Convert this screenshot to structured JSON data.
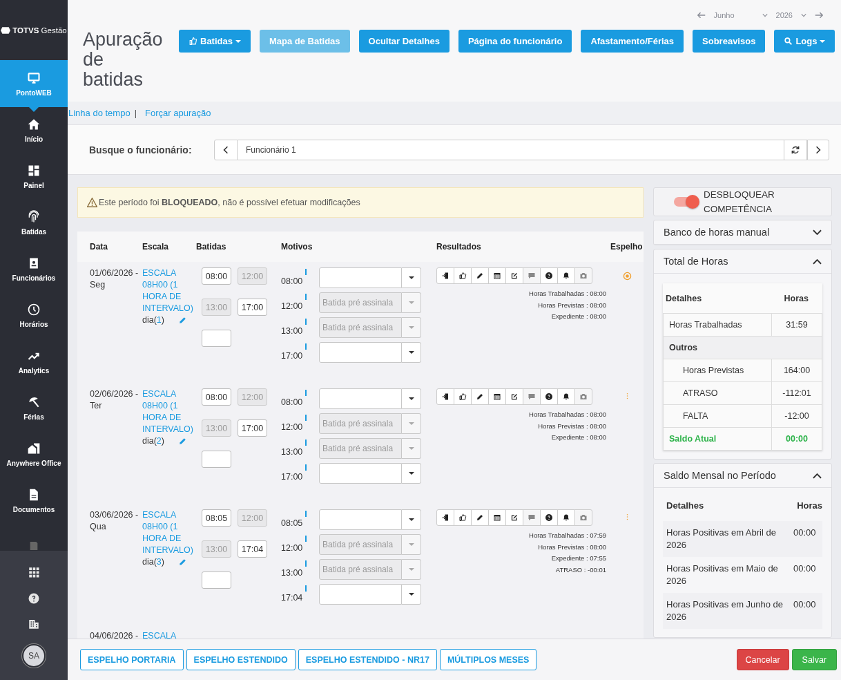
{
  "sidebar": {
    "logo": "**TOTVS** Gestão",
    "items": [
      {
        "label": "PontoWEB",
        "selected": true
      },
      {
        "label": "Início",
        "selected": false
      },
      {
        "label": "Painel",
        "selected": false
      },
      {
        "label": "Batidas",
        "selected": false
      },
      {
        "label": "Funcionários",
        "selected": false
      },
      {
        "label": "Horários",
        "selected": false
      },
      {
        "label": "Analytics",
        "selected": false
      },
      {
        "label": "Férias",
        "selected": false
      },
      {
        "label": "Anywhere Office",
        "selected": false
      },
      {
        "label": "Documentos",
        "selected": false
      },
      {
        "selected": false
      }
    ],
    "avatar": "SA"
  },
  "period": {
    "month": "Junho",
    "year": "2026"
  },
  "title": "Apuração de batidas",
  "toolbar": [
    {
      "label": "Batidas",
      "caret": true,
      "disabled": false
    },
    {
      "label": "Mapa de Batidas",
      "caret": false,
      "disabled": true
    },
    {
      "label": "Ocultar Detalhes",
      "caret": false,
      "disabled": false
    },
    {
      "label": "Página do funcionário",
      "caret": false,
      "disabled": false
    },
    {
      "label": "Afastamento/Férias",
      "caret": false,
      "disabled": false
    },
    {
      "label": "Sobreavisos",
      "caret": false,
      "disabled": false
    },
    {
      "label": "Logs",
      "caret": true,
      "disabled": false
    }
  ],
  "links": {
    "items": [
      "Linha do tempo",
      "Forçar apuração"
    ],
    "separator": "|"
  },
  "search": {
    "label": "Busque o funcionário:",
    "value": "Funcionário 1"
  },
  "notice": "Este período foi **BLOQUEADO**, não é possível efetuar modificações",
  "table": {
    "columns": [
      "Data",
      "Escala",
      "Batidas",
      "Motivos",
      "Resultados",
      "Espelho"
    ],
    "actions": [
      {
        "disabled": false
      },
      {
        "disabled": false
      },
      {
        "disabled": false
      },
      {
        "disabled": false
      },
      {
        "disabled": false
      },
      {
        "disabled": true
      },
      {
        "disabled": false
      },
      {
        "disabled": false
      },
      {
        "disabled": true
      }
    ],
    "days": [
      {
        "date": "01/06/2026 -",
        "weekday": "Seg",
        "escala": "ESCALA 08H00 (1 HORA DE INTERVALO)",
        "counter": {
          "prefix": "dia(",
          "number": "1",
          "suffix": ")"
        },
        "punches": [
          {
            "value": "08:00",
            "disabled": false
          },
          {
            "value": "12:00",
            "disabled": true
          },
          {
            "value": "13:00",
            "disabled": true
          },
          {
            "value": "17:00",
            "disabled": false
          }
        ],
        "motives": [
          {
            "time": "08:00",
            "disabled": false
          },
          {
            "time": "12:00",
            "disabled": true,
            "placeholder": "Batida pré assinala"
          },
          {
            "time": "13:00",
            "disabled": true,
            "placeholder": "Batida pré assinala"
          },
          {
            "time": "17:00",
            "disabled": false
          }
        ],
        "summary": [
          "Horas Trabalhadas : 08:00",
          "Horas Previstas : 08:00",
          "Expediente : 08:00"
        ],
        "mirror": {
          "kind": "target"
        }
      },
      {
        "date": "02/06/2026 -",
        "weekday": "Ter",
        "escala": "ESCALA 08H00 (1 HORA DE INTERVALO)",
        "counter": {
          "prefix": "dia(",
          "number": "2",
          "suffix": ")"
        },
        "punches": [
          {
            "value": "08:00",
            "disabled": false
          },
          {
            "value": "12:00",
            "disabled": true
          },
          {
            "value": "13:00",
            "disabled": true
          },
          {
            "value": "17:00",
            "disabled": false
          }
        ],
        "motives": [
          {
            "time": "08:00",
            "disabled": false
          },
          {
            "time": "12:00",
            "disabled": true,
            "placeholder": "Batida pré assinala"
          },
          {
            "time": "13:00",
            "disabled": true,
            "placeholder": "Batida pré assinala"
          },
          {
            "time": "17:00",
            "disabled": false
          }
        ],
        "summary": [
          "Horas Trabalhadas : 08:00",
          "Horas Previstas : 08:00",
          "Expediente : 08:00"
        ],
        "mirror": {
          "kind": "menu"
        }
      },
      {
        "date": "03/06/2026 -",
        "weekday": "Qua",
        "escala": "ESCALA 08H00 (1 HORA DE INTERVALO)",
        "counter": {
          "prefix": "dia(",
          "number": "3",
          "suffix": ")"
        },
        "punches": [
          {
            "value": "08:05",
            "disabled": false
          },
          {
            "value": "12:00",
            "disabled": true
          },
          {
            "value": "13:00",
            "disabled": true
          },
          {
            "value": "17:04",
            "disabled": false
          }
        ],
        "motives": [
          {
            "time": "08:05",
            "disabled": false
          },
          {
            "time": "12:00",
            "disabled": true,
            "placeholder": "Batida pré assinala"
          },
          {
            "time": "13:00",
            "disabled": true,
            "placeholder": "Batida pré assinala"
          },
          {
            "time": "17:04",
            "disabled": false
          }
        ],
        "summary": [
          "Horas Trabalhadas : 07:59",
          "Horas Previstas : 08:00",
          "Expediente : 07:55",
          "ATRASO : -00:01"
        ],
        "mirror": {
          "kind": "menu"
        }
      },
      {
        "date": "04/06/2026 -",
        "escala": "ESCALA"
      }
    ]
  },
  "right_panel": {
    "unlock": {
      "label": "DESBLOQUEAR COMPETÊNCIA",
      "on": true
    },
    "sections": [
      {
        "title": "Banco de horas manual",
        "expanded": false
      },
      {
        "title": "Total de Horas",
        "expanded": true,
        "kind": "totals",
        "columns": [
          "Detalhes",
          "Horas"
        ],
        "rows": [
          {
            "kind": "row",
            "label": "Horas Trabalhadas",
            "value": "31:59"
          },
          {
            "kind": "group",
            "label": "Outros"
          },
          {
            "kind": "sub",
            "label": "Horas Previstas",
            "value": "164:00"
          },
          {
            "kind": "sub",
            "label": "ATRASO",
            "value": "-112:01"
          },
          {
            "kind": "sub",
            "label": "FALTA",
            "value": "-12:00"
          },
          {
            "kind": "total",
            "label": "Saldo Atual",
            "value": "00:00"
          }
        ]
      },
      {
        "title": "Saldo Mensal no Período",
        "expanded": true,
        "kind": "balance",
        "columns": [
          "Detalhes",
          "Horas"
        ],
        "rows": [
          {
            "label": "Horas Positivas em Abril de 2026",
            "value": "00:00"
          },
          {
            "label": "Horas Positivas em Maio de 2026",
            "value": "00:00"
          },
          {
            "label": "Horas Positivas em Junho de 2026",
            "value": "00:00"
          }
        ]
      }
    ]
  },
  "footer": [
    {
      "label": "ESPELHO PORTARIA",
      "kind": "outline"
    },
    {
      "label": "ESPELHO ESTENDIDO",
      "kind": "outline"
    },
    {
      "label": "ESPELHO ESTENDIDO - NR17",
      "kind": "outline"
    },
    {
      "label": "MÚLTIPLOS MESES",
      "kind": "outline"
    },
    {
      "label": "Cancelar",
      "kind": "danger"
    },
    {
      "label": "Salvar",
      "kind": "success"
    }
  ]
}
